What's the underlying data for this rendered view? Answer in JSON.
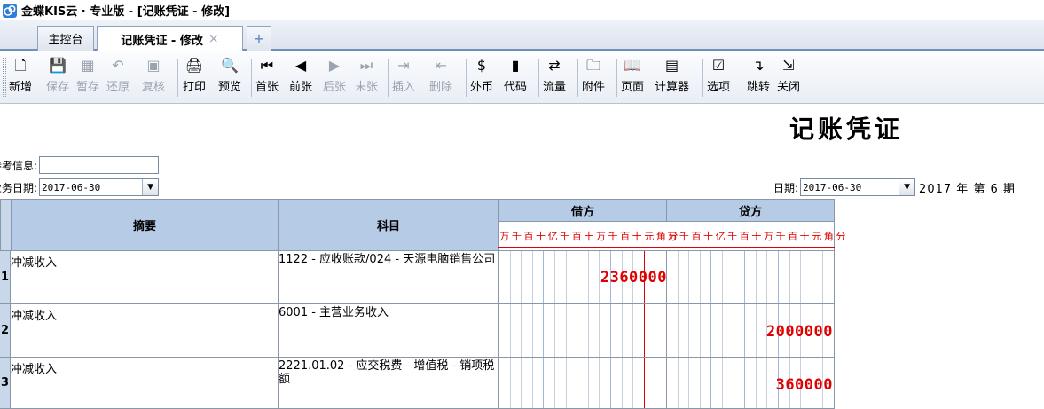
{
  "window": {
    "title": "金蝶KIS云 · 专业版 - [记账凭证 - 修改]",
    "logo_icon": "kingdee-logo-icon"
  },
  "tabs": [
    {
      "label": "主控台",
      "active": false
    },
    {
      "label": "记账凭证 - 修改",
      "active": true,
      "close": "×"
    },
    {
      "label": "+",
      "add": true
    }
  ],
  "toolbar": {
    "buttons": [
      {
        "label": "新增",
        "icon": "new-doc-icon",
        "glyph": "🗋",
        "enabled": true
      },
      {
        "label": "保存",
        "icon": "save-icon",
        "glyph": "💾",
        "enabled": false
      },
      {
        "label": "暂存",
        "icon": "stash-icon",
        "glyph": "▦",
        "enabled": false
      },
      {
        "label": "还原",
        "icon": "restore-icon",
        "glyph": "↶",
        "enabled": false
      },
      {
        "label": "复核",
        "icon": "review-icon",
        "glyph": "▣",
        "enabled": false
      },
      {
        "label": "打印",
        "icon": "print-icon",
        "glyph": "🖨",
        "enabled": true
      },
      {
        "label": "预览",
        "icon": "preview-icon",
        "glyph": "🔍",
        "enabled": true
      },
      {
        "label": "首张",
        "icon": "first-icon",
        "glyph": "⏮",
        "enabled": true
      },
      {
        "label": "前张",
        "icon": "prev-icon",
        "glyph": "◀",
        "enabled": true
      },
      {
        "label": "后张",
        "icon": "next-icon",
        "glyph": "▶",
        "enabled": false
      },
      {
        "label": "末张",
        "icon": "last-icon",
        "glyph": "⏭",
        "enabled": false
      },
      {
        "label": "插入",
        "icon": "insert-row-icon",
        "glyph": "⇥",
        "enabled": false
      },
      {
        "label": "删除",
        "icon": "delete-row-icon",
        "glyph": "⇤",
        "enabled": false
      },
      {
        "label": "外币",
        "icon": "currency-icon",
        "glyph": "$",
        "enabled": true
      },
      {
        "label": "代码",
        "icon": "code-icon",
        "glyph": "▮",
        "enabled": true
      },
      {
        "label": "流量",
        "icon": "cashflow-icon",
        "glyph": "⇄",
        "enabled": true
      },
      {
        "label": "附件",
        "icon": "attachment-icon",
        "glyph": "🗀",
        "enabled": true
      },
      {
        "label": "页面",
        "icon": "page-icon",
        "glyph": "📖",
        "enabled": true
      },
      {
        "label": "计算器",
        "icon": "calculator-icon",
        "glyph": "▤",
        "enabled": true
      },
      {
        "label": "选项",
        "icon": "options-icon",
        "glyph": "☑",
        "enabled": true
      },
      {
        "label": "跳转",
        "icon": "jump-icon",
        "glyph": "↴",
        "enabled": true
      },
      {
        "label": "关闭",
        "icon": "exit-icon",
        "glyph": "⇲",
        "enabled": true
      }
    ]
  },
  "voucher": {
    "title": "记账凭证",
    "ref_label": "参考信息:",
    "ref_value": "",
    "biz_date_label": "业务日期:",
    "biz_date": "2017-06-30",
    "date_label": "日期:",
    "date": "2017-06-30",
    "period_text": "2017 年 第 6 期"
  },
  "grid": {
    "headers": {
      "summary": "摘要",
      "account": "科目",
      "debit": "借方",
      "credit": "贷方"
    },
    "digit_units": [
      "万",
      "千",
      "百",
      "十",
      "亿",
      "千",
      "百",
      "十",
      "万",
      "千",
      "百",
      "十",
      "元",
      "角",
      "分"
    ],
    "rows": [
      {
        "num": "1",
        "summary": "冲减收入",
        "account": "1122 - 应收账款/024 - 天源电脑销售公司",
        "debit": "2360000",
        "credit": ""
      },
      {
        "num": "2",
        "summary": "冲减收入",
        "account": "6001 - 主营业务收入",
        "debit": "",
        "credit": "2000000"
      },
      {
        "num": "3",
        "summary": "冲减收入",
        "account": "2221.01.02 - 应交税费 - 增值税 - 销项税额",
        "debit": "",
        "credit": "360000"
      }
    ]
  },
  "colors": {
    "header_bg": "#b6cce6",
    "amount_red": "#e00000",
    "rownum_bg": "#c9d7ea"
  }
}
